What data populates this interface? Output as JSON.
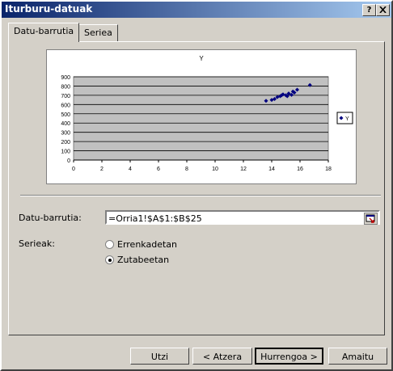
{
  "window": {
    "title": "Iturburu-datuak",
    "help_button": "?",
    "close_button": "X"
  },
  "tabs": [
    {
      "label": "Datu-barrutia",
      "active": true
    },
    {
      "label": "Seriea",
      "active": false
    }
  ],
  "chart_data": {
    "type": "scatter",
    "title": "Y",
    "xlabel": "",
    "ylabel": "",
    "xlim": [
      0,
      18
    ],
    "ylim": [
      0,
      900
    ],
    "xticks": [
      0,
      2,
      4,
      6,
      8,
      10,
      12,
      14,
      16,
      18
    ],
    "yticks": [
      0,
      100,
      200,
      300,
      400,
      500,
      600,
      700,
      800,
      900
    ],
    "plot_background": "#c0c0c0",
    "marker_color": "#000080",
    "grid": true,
    "legend_position": "right",
    "series": [
      {
        "name": "Y",
        "x": [
          13.6,
          14.0,
          14.2,
          14.4,
          14.6,
          14.7,
          14.8,
          15.0,
          15.1,
          15.2,
          15.4,
          15.5,
          15.6,
          15.8,
          16.7
        ],
        "y": [
          640,
          650,
          660,
          680,
          690,
          700,
          710,
          700,
          690,
          720,
          705,
          740,
          730,
          760,
          810
        ]
      }
    ]
  },
  "range": {
    "label": "Datu-barrutia:",
    "value": "=Orria1!$A$1:$B$25"
  },
  "series_in": {
    "label": "Serieak:",
    "options": [
      {
        "label": "Errenkadetan",
        "selected": false
      },
      {
        "label": "Zutabeetan",
        "selected": true
      }
    ]
  },
  "buttons": {
    "cancel": "Utzi",
    "back": "< Atzera",
    "next": "Hurrengoa >",
    "finish": "Amaitu"
  }
}
